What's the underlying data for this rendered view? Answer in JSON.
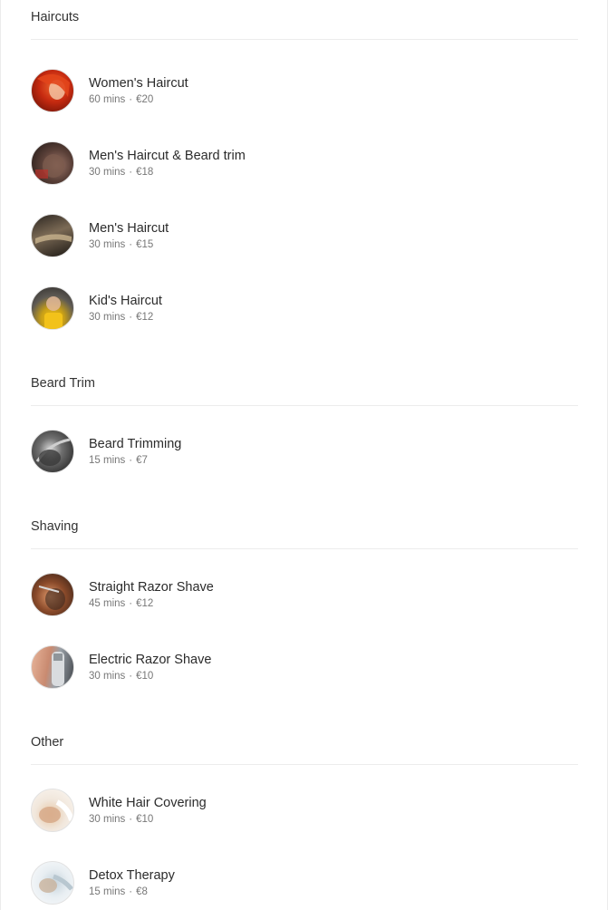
{
  "categories": [
    {
      "title": "Haircuts",
      "services": [
        {
          "name": "Women's Haircut",
          "duration": "60 mins",
          "price": "€20",
          "icon": "womens-haircut-photo"
        },
        {
          "name": "Men's Haircut & Beard trim",
          "duration": "30 mins",
          "price": "€18",
          "icon": "mens-haircut-beard-photo"
        },
        {
          "name": "Men's Haircut",
          "duration": "30 mins",
          "price": "€15",
          "icon": "mens-haircut-photo"
        },
        {
          "name": "Kid's Haircut",
          "duration": "30 mins",
          "price": "€12",
          "icon": "kids-haircut-photo"
        }
      ]
    },
    {
      "title": "Beard Trim",
      "services": [
        {
          "name": "Beard Trimming",
          "duration": "15 mins",
          "price": "€7",
          "icon": "beard-trimming-photo"
        }
      ]
    },
    {
      "title": "Shaving",
      "services": [
        {
          "name": "Straight Razor Shave",
          "duration": "45 mins",
          "price": "€12",
          "icon": "straight-razor-photo"
        },
        {
          "name": "Electric Razor Shave",
          "duration": "30 mins",
          "price": "€10",
          "icon": "electric-razor-photo"
        }
      ]
    },
    {
      "title": "Other",
      "services": [
        {
          "name": "White Hair Covering",
          "duration": "30 mins",
          "price": "€10",
          "icon": "hair-covering-photo"
        },
        {
          "name": "Detox Therapy",
          "duration": "15 mins",
          "price": "€8",
          "icon": "detox-therapy-photo"
        }
      ]
    }
  ],
  "separator": "·"
}
